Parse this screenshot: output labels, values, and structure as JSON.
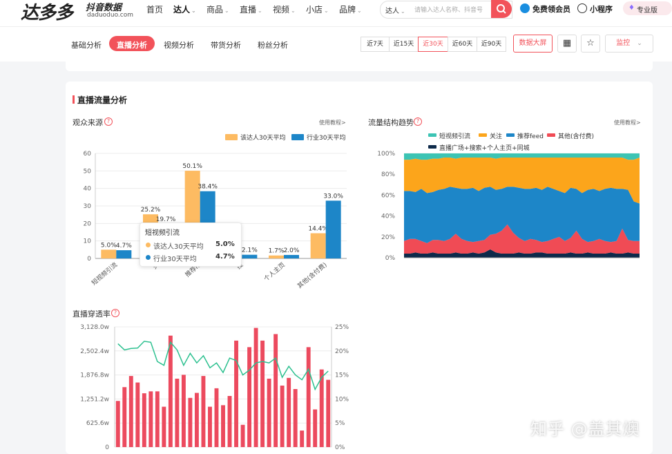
{
  "brand": {
    "logo": "达多多",
    "sub": "抖音数据",
    "domain": "daduoduo.com"
  },
  "nav": {
    "items": [
      {
        "label": "首页",
        "dropdown": false
      },
      {
        "label": "达人",
        "dropdown": true,
        "active": true
      },
      {
        "label": "商品",
        "dropdown": true
      },
      {
        "label": "直播",
        "dropdown": true
      },
      {
        "label": "视频",
        "dropdown": true
      },
      {
        "label": "小店",
        "dropdown": true
      },
      {
        "label": "品牌",
        "dropdown": true
      }
    ],
    "search_scope": "达人",
    "search_placeholder": "请输入达人名称、抖音号",
    "vip_label": "免费领会员",
    "mini_label": "小程序",
    "pro_label": "专业版"
  },
  "subnav": {
    "tabs": [
      {
        "label": "基础分析"
      },
      {
        "label": "直播分析",
        "active": true
      },
      {
        "label": "视频分析"
      },
      {
        "label": "带货分析"
      },
      {
        "label": "粉丝分析"
      }
    ],
    "ranges": [
      "近7天",
      "近15天",
      "近30天",
      "近60天",
      "近90天"
    ],
    "active_range": "近30天",
    "bigscreen_label": "数据大屏",
    "monitor_label": "监控"
  },
  "section": {
    "title": "直播流量分析"
  },
  "colors": {
    "primary": "#f2525a",
    "orange": "#fdbb62",
    "blue": "#1d86c8",
    "teal": "#3cc4b4",
    "navy": "#0e2a4a"
  },
  "tooltip": {
    "title": "短视频引流",
    "rows": [
      {
        "name": "该达人30天平均",
        "value": "5.0%",
        "color": "#fdbb62"
      },
      {
        "name": "行业30天平均",
        "value": "4.7%",
        "color": "#1d86c8"
      }
    ]
  },
  "watermark": "知乎 @盖其燠",
  "chart_data": [
    {
      "type": "bar",
      "title": "观众来源",
      "tutorial": "使用教程>",
      "categories": [
        "短视频引流",
        "关注",
        "推荐feed",
        "搜索",
        "个人主页",
        "其他(含付费)"
      ],
      "tick_labels": [
        "短视频引流",
        "关",
        "推荐fe",
        "搜",
        "个人主页",
        "其他(含付费)"
      ],
      "series": [
        {
          "name": "该达人30天平均",
          "values": [
            5.0,
            25.2,
            50.1,
            0,
            1.7,
            14.4
          ],
          "labels": [
            "5.0%",
            "25.2%",
            "50.1%",
            "",
            "1.7%",
            "14.4%"
          ],
          "color": "#fdbb62"
        },
        {
          "name": "行业30天平均",
          "values": [
            4.7,
            19.7,
            38.4,
            2.1,
            2.0,
            33.0
          ],
          "labels": [
            "4.7%",
            "19.7%",
            "38.4%",
            "2.1%",
            "2.0%",
            "33.0%"
          ],
          "color": "#1d86c8"
        }
      ],
      "ylim": [
        0,
        60
      ],
      "yticks": [
        0,
        10,
        20,
        30,
        40,
        50,
        60
      ],
      "legend": "top-right"
    },
    {
      "type": "area",
      "title": "流量结构趋势",
      "tutorial": "使用教程>",
      "stacked_percent": true,
      "yticks": [
        "0%",
        "20%",
        "40%",
        "60%",
        "80%",
        "100%"
      ],
      "legend": "top",
      "series": [
        {
          "name": "直播广场+搜索+个人主页+同城",
          "color": "#0e2a4a",
          "values": [
            4,
            4,
            5,
            4,
            4,
            5,
            4,
            4,
            4,
            5,
            4,
            4,
            5,
            4,
            5,
            8,
            5,
            4,
            4,
            4,
            5,
            4,
            4,
            5,
            5,
            4,
            4,
            4,
            4,
            5,
            4,
            4,
            5,
            4,
            4,
            4,
            5,
            4,
            4,
            5,
            4,
            4
          ]
        },
        {
          "name": "其他(含付费)",
          "color": "#f04b55",
          "values": [
            12,
            14,
            13,
            12,
            10,
            12,
            13,
            12,
            14,
            18,
            14,
            12,
            10,
            12,
            12,
            14,
            18,
            22,
            28,
            20,
            14,
            12,
            14,
            12,
            10,
            12,
            14,
            16,
            12,
            14,
            22,
            14,
            10,
            12,
            14,
            12,
            10,
            12,
            24,
            12,
            12,
            12
          ]
        },
        {
          "name": "推荐feed",
          "color": "#1d86c8",
          "values": [
            48,
            46,
            45,
            50,
            48,
            46,
            48,
            50,
            50,
            44,
            48,
            50,
            52,
            48,
            50,
            46,
            42,
            40,
            36,
            44,
            48,
            50,
            48,
            50,
            50,
            52,
            48,
            44,
            46,
            48,
            40,
            44,
            50,
            50,
            46,
            50,
            52,
            50,
            38,
            48,
            38,
            36
          ]
        },
        {
          "name": "关注",
          "color": "#fca51b",
          "values": [
            30,
            30,
            32,
            28,
            32,
            32,
            30,
            30,
            28,
            28,
            30,
            30,
            29,
            32,
            29,
            28,
            30,
            30,
            28,
            28,
            29,
            30,
            30,
            29,
            31,
            28,
            30,
            32,
            34,
            29,
            30,
            34,
            31,
            30,
            32,
            30,
            29,
            30,
            30,
            29,
            40,
            44
          ]
        },
        {
          "name": "短视频引流",
          "color": "#3cc4b4",
          "values": [
            6,
            6,
            5,
            6,
            6,
            5,
            5,
            4,
            4,
            5,
            4,
            4,
            4,
            4,
            4,
            4,
            5,
            4,
            4,
            4,
            4,
            4,
            4,
            4,
            4,
            4,
            4,
            4,
            4,
            4,
            4,
            4,
            4,
            4,
            4,
            4,
            4,
            4,
            4,
            6,
            6,
            4
          ]
        }
      ]
    },
    {
      "type": "bar",
      "title": "直播穿透率",
      "overlay_line": true,
      "yticks_left": [
        "0",
        "625.6w",
        "1,251.2w",
        "1,876.8w",
        "2,502.4w",
        "3,128.0w"
      ],
      "yticks_right": [
        "0%",
        "5%",
        "10%",
        "15%",
        "20%",
        "25%"
      ],
      "ylim_left": [
        0,
        3128
      ],
      "ylim_right": [
        0,
        25
      ],
      "bar_color": "#ec4a5e",
      "line_color": "#2cc08f",
      "bars": [
        1200,
        1560,
        1850,
        1680,
        1400,
        1450,
        1450,
        1050,
        2900,
        1780,
        1880,
        1280,
        1410,
        1850,
        1050,
        1530,
        1090,
        1330,
        2770,
        580,
        2600,
        3100,
        2770,
        1780,
        2940,
        1600,
        1800,
        1510,
        430,
        2600,
        980,
        2020,
        1750
      ],
      "rates": [
        21.5,
        20.2,
        20.5,
        20.6,
        22.0,
        21.8,
        17.8,
        17.0,
        21.8,
        20.2,
        17.0,
        19.5,
        17.5,
        19.0,
        16.5,
        17.5,
        15.5,
        18.5,
        18.0,
        15.0,
        16.0,
        17.5,
        17.8,
        17.5,
        18.5,
        14.5,
        16.8,
        15.0,
        14.0,
        16.2,
        12.0,
        14.5,
        15.8
      ]
    }
  ]
}
